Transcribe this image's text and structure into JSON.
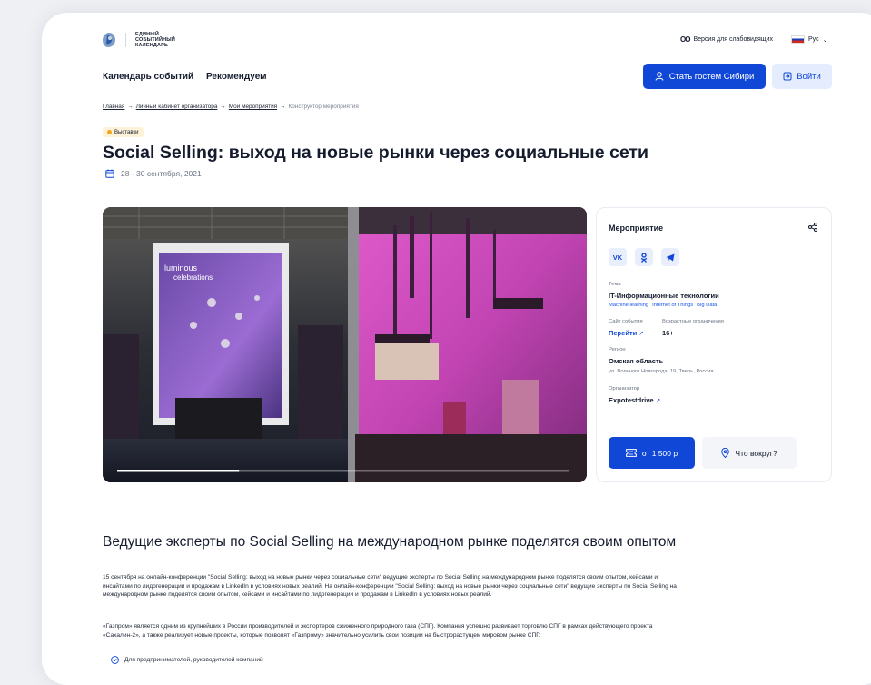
{
  "header": {
    "brand": "ЕДИНЫЙ СОБЫТИЙНЫЙ КАЛЕНДАРЬ",
    "accessibility": "Версия для слабовидящих",
    "language": "Рус"
  },
  "nav": {
    "items": [
      "Календарь событий",
      "Рекомендуем"
    ],
    "guest_button": "Стать гостем Сибири",
    "login_button": "Войти"
  },
  "breadcrumbs": [
    "Главная",
    "Личный кабинет организатора",
    "Мои мероприятия",
    "Конструктор мероприятия"
  ],
  "event": {
    "badge": "Выставки",
    "title": "Social Selling: выход на новые рынки через социальные сети",
    "dates": "28 - 30 сентября, 2021"
  },
  "photo": {
    "sign_line1": "luminous",
    "sign_line2": "celebrations",
    "slider_progress": 0.27
  },
  "sidebar": {
    "heading": "Мероприятие",
    "socials": [
      "vk-icon",
      "ok-icon",
      "telegram-icon"
    ],
    "topic_label": "Тема",
    "topic_value": "IT-Информационные технологии",
    "tags": [
      "Machine learning",
      "Internet of Things",
      "Big Data"
    ],
    "site_label": "Сайт события",
    "site_link": "Перейти",
    "age_label": "Возрастные ограничения",
    "age_value": "16+",
    "region_label": "Регион",
    "region_value": "Омская область",
    "address": "ул. Вольного Новгорода, 19, Тверь, Россия",
    "organizer_label": "Организатор",
    "organizer_value": "Expotestdrive",
    "price_button": "от 1 500 р",
    "around_button": "Что вокруг?"
  },
  "content": {
    "heading": "Ведущие эксперты по Social Selling на международном рынке поделятся своим опытом",
    "p1_lines": [
      "15 сентября на онлайн-конференции \"Social Selling: выход на новые рынки через социальные сети\" ведущие эксперты по Social Selling на международном рынке поделятся своим опытом, кейсами и",
      "инсайтами по лидогенерации и продажам в LinkedIn в условиях новых реалий. На онлайн-конференции \"Social Selling: выход на новые рынки через социальные сети\" ведущие эксперты по Social Selling на",
      "международном рынке поделятся своим опытом, кейсами и инсайтами по лидогенерации и продажам в LinkedIn в условиях новых реалий."
    ],
    "p2_lines": [
      "«Газпром» является одним из крупнейших в России производителей и экспортеров сжиженного природного газа (СПГ). Компания успешно развивает торговлю СПГ в рамках действующего проекта",
      "«Сахалин-2», а также реализует новые проекты, которые позволят «Газпрому» значительно усилить свои позиции на быстрорастущем мировом рынке СПГ:"
    ],
    "list_item": "Для предпринимателей, руководителей компаний"
  },
  "colors": {
    "primary": "#1147d6",
    "light": "#e4ecfd",
    "badge_bg": "#fdf1d7",
    "badge_dot": "#f5a31a"
  }
}
